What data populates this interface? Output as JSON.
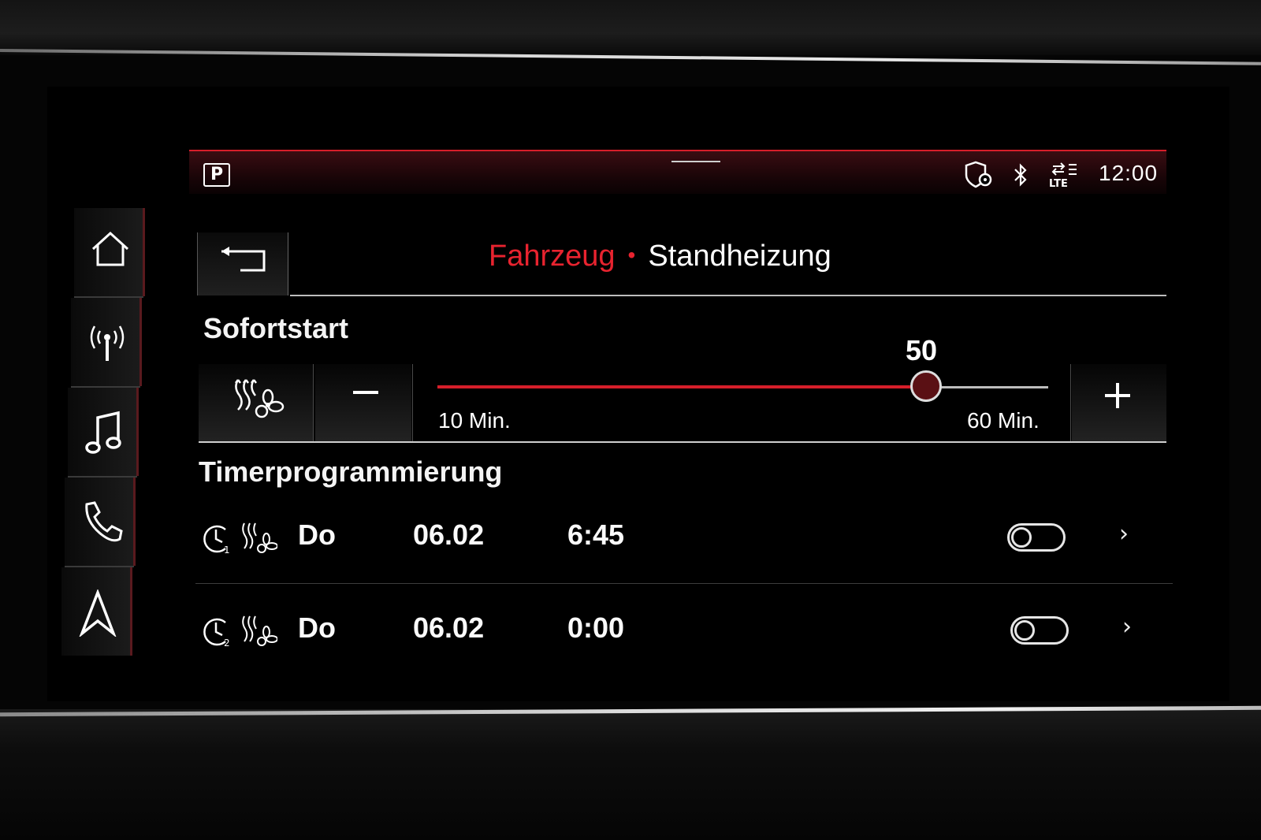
{
  "status_bar": {
    "park_label": "P",
    "time": "12:00",
    "icons": [
      "shield-location-icon",
      "bluetooth-icon",
      "lte-data-icon"
    ],
    "lte_label": "LTE"
  },
  "nav": {
    "items": [
      "home-icon",
      "radio-icon",
      "music-icon",
      "phone-icon",
      "navigation-icon"
    ]
  },
  "header": {
    "breadcrumb_parent": "Fahrzeug",
    "breadcrumb_separator": "•",
    "breadcrumb_current": "Standheizung"
  },
  "sofortstart": {
    "title": "Sofortstart",
    "value": "50",
    "value_number": 50,
    "min": 10,
    "max": 60,
    "min_label": "10 Min.",
    "max_label": "60 Min."
  },
  "timer": {
    "title": "Timerprogrammierung",
    "rows": [
      {
        "index": "1",
        "day": "Do",
        "date": "06.02",
        "time": "6:45",
        "enabled": false
      },
      {
        "index": "2",
        "day": "Do",
        "date": "06.02",
        "time": "0:00",
        "enabled": false
      }
    ]
  },
  "colors": {
    "accent": "#d61e2a",
    "accent_text": "#e8232f",
    "background": "#000000",
    "text": "#ffffff"
  }
}
